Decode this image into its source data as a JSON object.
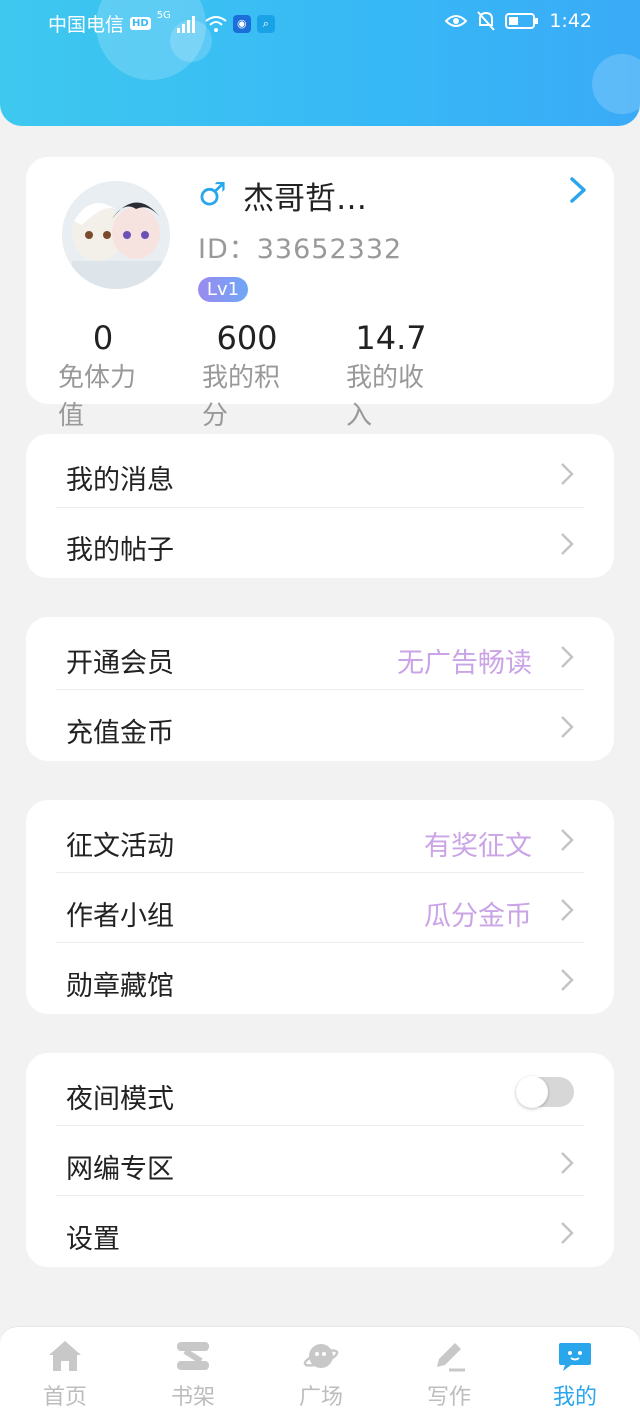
{
  "status_bar": {
    "carrier": "中国电信",
    "hd": "HD",
    "network": "5G",
    "time": "1:42"
  },
  "profile": {
    "gender_symbol": "♂",
    "name": "杰哥哲…",
    "id_text": "ID：33652332",
    "level": "Lv1",
    "stats": [
      {
        "value": "0",
        "label": "免体力值"
      },
      {
        "value": "600",
        "label": "我的积分"
      },
      {
        "value": "14.7",
        "label": "我的收入"
      }
    ]
  },
  "menu_group_1": [
    {
      "label": "我的消息",
      "extra": ""
    },
    {
      "label": "我的帖子",
      "extra": ""
    }
  ],
  "menu_group_2": [
    {
      "label": "开通会员",
      "extra": "无广告畅读"
    },
    {
      "label": "充值金币",
      "extra": ""
    }
  ],
  "menu_group_3": [
    {
      "label": "征文活动",
      "extra": "有奖征文"
    },
    {
      "label": "作者小组",
      "extra": "瓜分金币"
    },
    {
      "label": "勋章藏馆",
      "extra": ""
    }
  ],
  "menu_group_4": [
    {
      "label": "夜间模式",
      "toggle": false
    },
    {
      "label": "网编专区",
      "extra": ""
    },
    {
      "label": "设置",
      "extra": ""
    }
  ],
  "tabbar": [
    {
      "label": "首页",
      "icon": "home-icon",
      "active": false
    },
    {
      "label": "书架",
      "icon": "bookshelf-icon",
      "active": false
    },
    {
      "label": "广场",
      "icon": "planet-icon",
      "active": false
    },
    {
      "label": "写作",
      "icon": "pen-icon",
      "active": false
    },
    {
      "label": "我的",
      "icon": "chat-bubble-icon",
      "active": true
    }
  ],
  "colors": {
    "accent": "#2aa6ec",
    "header_start": "#3ec8ef",
    "header_end": "#3aabf7",
    "promo_text": "#caa4e6"
  }
}
